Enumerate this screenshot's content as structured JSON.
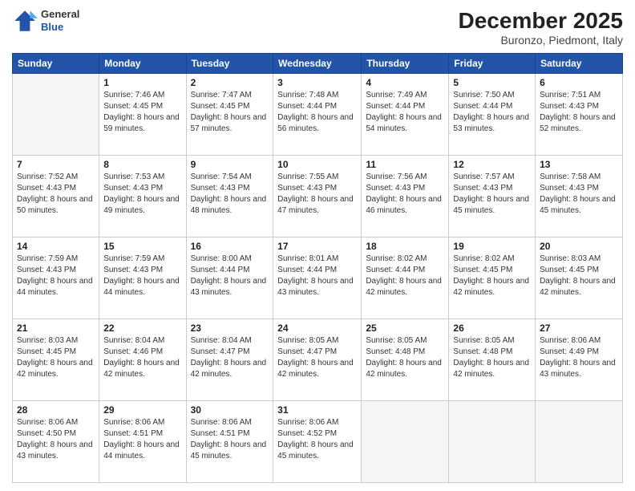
{
  "header": {
    "logo_general": "General",
    "logo_blue": "Blue",
    "month": "December 2025",
    "location": "Buronzo, Piedmont, Italy"
  },
  "weekdays": [
    "Sunday",
    "Monday",
    "Tuesday",
    "Wednesday",
    "Thursday",
    "Friday",
    "Saturday"
  ],
  "weeks": [
    [
      {
        "day": "",
        "empty": true
      },
      {
        "day": "1",
        "sunrise": "7:46 AM",
        "sunset": "4:45 PM",
        "daylight": "8 hours and 59 minutes."
      },
      {
        "day": "2",
        "sunrise": "7:47 AM",
        "sunset": "4:45 PM",
        "daylight": "8 hours and 57 minutes."
      },
      {
        "day": "3",
        "sunrise": "7:48 AM",
        "sunset": "4:44 PM",
        "daylight": "8 hours and 56 minutes."
      },
      {
        "day": "4",
        "sunrise": "7:49 AM",
        "sunset": "4:44 PM",
        "daylight": "8 hours and 54 minutes."
      },
      {
        "day": "5",
        "sunrise": "7:50 AM",
        "sunset": "4:44 PM",
        "daylight": "8 hours and 53 minutes."
      },
      {
        "day": "6",
        "sunrise": "7:51 AM",
        "sunset": "4:43 PM",
        "daylight": "8 hours and 52 minutes."
      }
    ],
    [
      {
        "day": "7",
        "sunrise": "7:52 AM",
        "sunset": "4:43 PM",
        "daylight": "8 hours and 50 minutes."
      },
      {
        "day": "8",
        "sunrise": "7:53 AM",
        "sunset": "4:43 PM",
        "daylight": "8 hours and 49 minutes."
      },
      {
        "day": "9",
        "sunrise": "7:54 AM",
        "sunset": "4:43 PM",
        "daylight": "8 hours and 48 minutes."
      },
      {
        "day": "10",
        "sunrise": "7:55 AM",
        "sunset": "4:43 PM",
        "daylight": "8 hours and 47 minutes."
      },
      {
        "day": "11",
        "sunrise": "7:56 AM",
        "sunset": "4:43 PM",
        "daylight": "8 hours and 46 minutes."
      },
      {
        "day": "12",
        "sunrise": "7:57 AM",
        "sunset": "4:43 PM",
        "daylight": "8 hours and 45 minutes."
      },
      {
        "day": "13",
        "sunrise": "7:58 AM",
        "sunset": "4:43 PM",
        "daylight": "8 hours and 45 minutes."
      }
    ],
    [
      {
        "day": "14",
        "sunrise": "7:59 AM",
        "sunset": "4:43 PM",
        "daylight": "8 hours and 44 minutes."
      },
      {
        "day": "15",
        "sunrise": "7:59 AM",
        "sunset": "4:43 PM",
        "daylight": "8 hours and 44 minutes."
      },
      {
        "day": "16",
        "sunrise": "8:00 AM",
        "sunset": "4:44 PM",
        "daylight": "8 hours and 43 minutes."
      },
      {
        "day": "17",
        "sunrise": "8:01 AM",
        "sunset": "4:44 PM",
        "daylight": "8 hours and 43 minutes."
      },
      {
        "day": "18",
        "sunrise": "8:02 AM",
        "sunset": "4:44 PM",
        "daylight": "8 hours and 42 minutes."
      },
      {
        "day": "19",
        "sunrise": "8:02 AM",
        "sunset": "4:45 PM",
        "daylight": "8 hours and 42 minutes."
      },
      {
        "day": "20",
        "sunrise": "8:03 AM",
        "sunset": "4:45 PM",
        "daylight": "8 hours and 42 minutes."
      }
    ],
    [
      {
        "day": "21",
        "sunrise": "8:03 AM",
        "sunset": "4:45 PM",
        "daylight": "8 hours and 42 minutes."
      },
      {
        "day": "22",
        "sunrise": "8:04 AM",
        "sunset": "4:46 PM",
        "daylight": "8 hours and 42 minutes."
      },
      {
        "day": "23",
        "sunrise": "8:04 AM",
        "sunset": "4:47 PM",
        "daylight": "8 hours and 42 minutes."
      },
      {
        "day": "24",
        "sunrise": "8:05 AM",
        "sunset": "4:47 PM",
        "daylight": "8 hours and 42 minutes."
      },
      {
        "day": "25",
        "sunrise": "8:05 AM",
        "sunset": "4:48 PM",
        "daylight": "8 hours and 42 minutes."
      },
      {
        "day": "26",
        "sunrise": "8:05 AM",
        "sunset": "4:48 PM",
        "daylight": "8 hours and 42 minutes."
      },
      {
        "day": "27",
        "sunrise": "8:06 AM",
        "sunset": "4:49 PM",
        "daylight": "8 hours and 43 minutes."
      }
    ],
    [
      {
        "day": "28",
        "sunrise": "8:06 AM",
        "sunset": "4:50 PM",
        "daylight": "8 hours and 43 minutes."
      },
      {
        "day": "29",
        "sunrise": "8:06 AM",
        "sunset": "4:51 PM",
        "daylight": "8 hours and 44 minutes."
      },
      {
        "day": "30",
        "sunrise": "8:06 AM",
        "sunset": "4:51 PM",
        "daylight": "8 hours and 45 minutes."
      },
      {
        "day": "31",
        "sunrise": "8:06 AM",
        "sunset": "4:52 PM",
        "daylight": "8 hours and 45 minutes."
      },
      {
        "day": "",
        "empty": true
      },
      {
        "day": "",
        "empty": true
      },
      {
        "day": "",
        "empty": true
      }
    ]
  ]
}
